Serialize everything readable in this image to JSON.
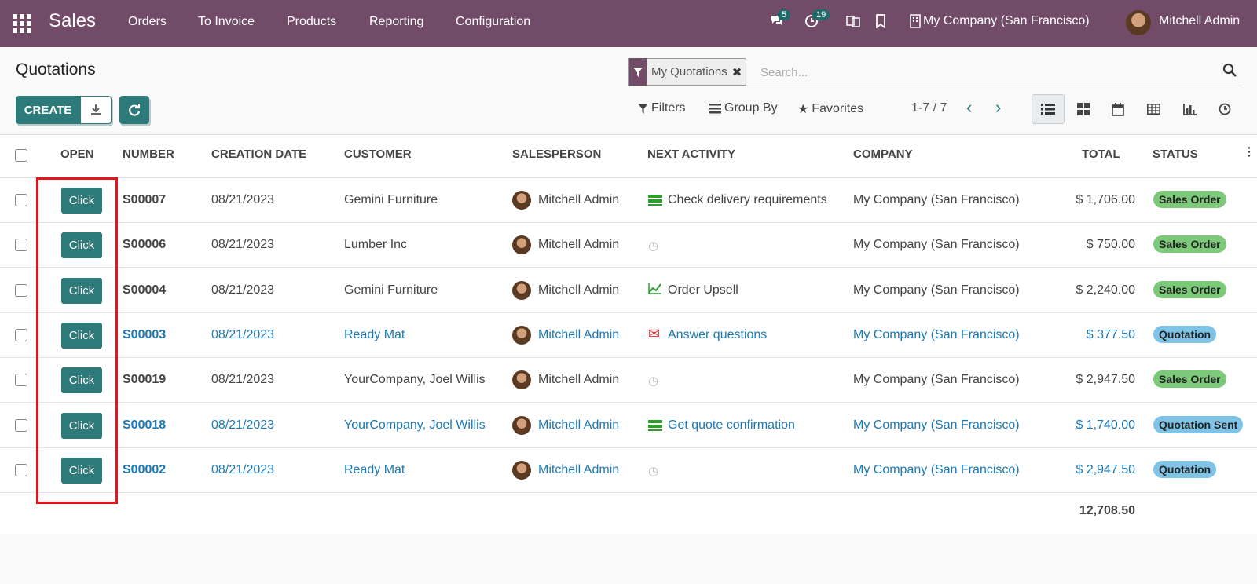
{
  "navbar": {
    "brand": "Sales",
    "menu": [
      "Orders",
      "To Invoice",
      "Products",
      "Reporting",
      "Configuration"
    ],
    "messages_count": "5",
    "activities_count": "19",
    "company": "My Company (San Francisco)",
    "user": "Mitchell Admin"
  },
  "control": {
    "title": "Quotations",
    "create_label": "CREATE",
    "facet_label": "My Quotations",
    "search_placeholder": "Search...",
    "filters_label": "Filters",
    "groupby_label": "Group By",
    "favorites_label": "Favorites",
    "pager": "1-7 / 7"
  },
  "table": {
    "headers": {
      "open": "Open",
      "number": "Number",
      "creation_date": "Creation Date",
      "customer": "Customer",
      "salesperson": "Salesperson",
      "next_activity": "Next Activity",
      "company": "Company",
      "total": "Total",
      "status": "Status"
    },
    "open_label": "Click",
    "rows": [
      {
        "number": "S00007",
        "date": "08/21/2023",
        "customer": "Gemini Furniture",
        "salesperson": "Mitchell Admin",
        "activity": "Check delivery requirements",
        "activity_icon": "todo-icon",
        "company": "My Company (San Francisco)",
        "total": "$ 1,706.00",
        "status": "Sales Order"
      },
      {
        "number": "S00006",
        "date": "08/21/2023",
        "customer": "Lumber Inc",
        "salesperson": "Mitchell Admin",
        "activity": "",
        "activity_icon": "clock-icon",
        "company": "My Company (San Francisco)",
        "total": "$ 750.00",
        "status": "Sales Order"
      },
      {
        "number": "S00004",
        "date": "08/21/2023",
        "customer": "Gemini Furniture",
        "salesperson": "Mitchell Admin",
        "activity": "Order Upsell",
        "activity_icon": "upsell-icon",
        "company": "My Company (San Francisco)",
        "total": "$ 2,240.00",
        "status": "Sales Order"
      },
      {
        "number": "S00003",
        "date": "08/21/2023",
        "customer": "Ready Mat",
        "salesperson": "Mitchell Admin",
        "activity": "Answer questions",
        "activity_icon": "mail-icon",
        "company": "My Company (San Francisco)",
        "total": "$ 377.50",
        "status": "Quotation"
      },
      {
        "number": "S00019",
        "date": "08/21/2023",
        "customer": "YourCompany, Joel Willis",
        "salesperson": "Mitchell Admin",
        "activity": "",
        "activity_icon": "clock-icon",
        "company": "My Company (San Francisco)",
        "total": "$ 2,947.50",
        "status": "Sales Order"
      },
      {
        "number": "S00018",
        "date": "08/21/2023",
        "customer": "YourCompany, Joel Willis",
        "salesperson": "Mitchell Admin",
        "activity": "Get quote confirmation",
        "activity_icon": "todo-icon",
        "company": "My Company (San Francisco)",
        "total": "$ 1,740.00",
        "status": "Quotation Sent"
      },
      {
        "number": "S00002",
        "date": "08/21/2023",
        "customer": "Ready Mat",
        "salesperson": "Mitchell Admin",
        "activity": "",
        "activity_icon": "clock-icon",
        "company": "My Company (San Francisco)",
        "total": "$ 2,947.50",
        "status": "Quotation"
      }
    ],
    "sum_total": "12,708.50"
  },
  "colors": {
    "navbar": "#714b67",
    "primary": "#2d7a7a",
    "link": "#1b7ab5",
    "sales_order": "#7cc97a",
    "quotation": "#7fc4e6",
    "highlight": "#e8141c"
  }
}
